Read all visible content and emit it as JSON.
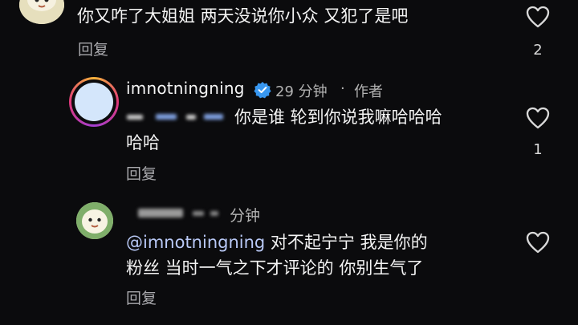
{
  "comments": [
    {
      "text": "你又咋了大姐姐 两天没说你小众 又犯了是吧",
      "reply_label": "回复",
      "like_count": "2"
    },
    {
      "username": "imnotningning",
      "time": "29 分钟",
      "separator": "·",
      "role_badge": "作者",
      "text_line1": "你是谁 轮到你说我嘛哈哈哈",
      "text_line2": "哈哈",
      "reply_label": "回复",
      "like_count": "1"
    },
    {
      "time_suffix": "分钟",
      "mention": "@imnotningning",
      "text_line1_rest": " 对不起宁宁 我是你的",
      "text_line2": "粉丝 当时一气之下才评论的 你别生气了",
      "reply_label": "回复"
    }
  ],
  "icons": {
    "like": "heart-outline-icon",
    "verified": "verified-badge-icon"
  },
  "colors": {
    "background": "#0b0b0d",
    "verified": "#3897f0",
    "mention": "#b9c9f7",
    "secondary_text": "#a9a9ad"
  }
}
